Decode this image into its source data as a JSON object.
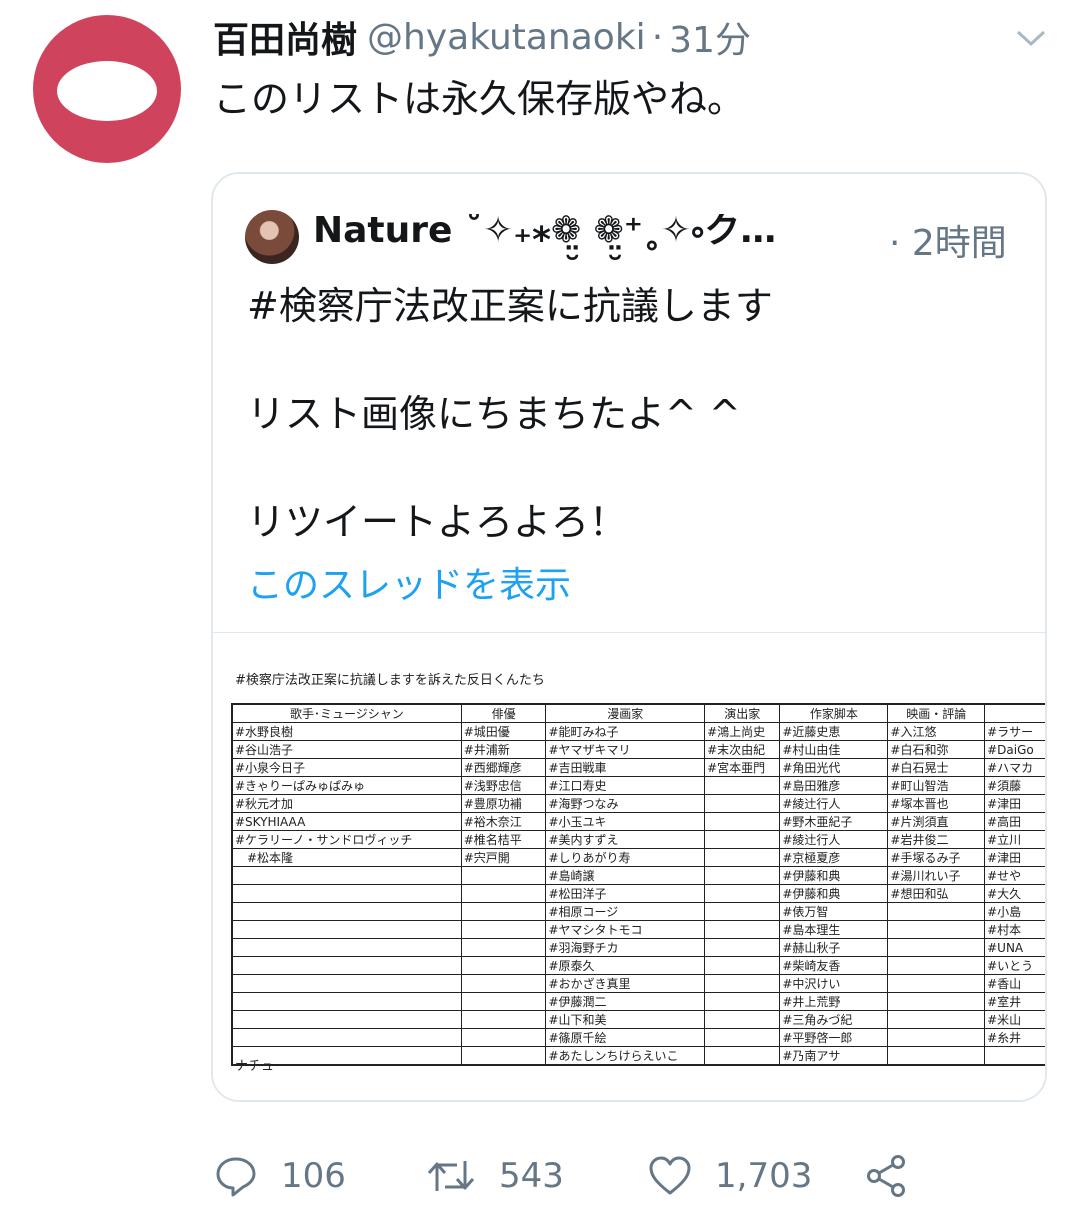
{
  "tweet": {
    "author_name": "百田尚樹",
    "author_handle": "@hyakutanaoki",
    "separator": "·",
    "time": "31分",
    "text": "このリストは永久保存版やね。"
  },
  "quoted": {
    "author_name": "Nature ˚✧₊⁎❁̤̮ ❁̤̮⁺˳✧༚ク…",
    "time": "· 2時間",
    "lines": [
      "#検察庁法改正案に抗議します",
      "",
      "リスト画像にちまちたよ^ ^",
      "",
      "リツイートよろよろ！"
    ],
    "show_thread": "このスレッドを表示",
    "image": {
      "title": "#検察庁法改正案に抗議しますを訴えた反日くんたち",
      "headers": [
        "歌手･ミュージシャン",
        "俳優",
        "漫画家",
        "演出家",
        "作家脚本",
        "映画・評論",
        ""
      ],
      "rows": [
        [
          "#水野良樹",
          "#城田優",
          "#能町みね子",
          "#鴻上尚史",
          "#近藤史恵",
          "#入江悠",
          "#ラサー"
        ],
        [
          "#谷山浩子",
          "#井浦新",
          "#ヤマザキマリ",
          "#末次由紀",
          "#村山由佳",
          "#白石和弥",
          "#DaiGo"
        ],
        [
          "#小泉今日子",
          "#西郷輝彦",
          "#吉田戦車",
          "#宮本亜門",
          "#角田光代",
          "#白石晃士",
          "#ハマカ"
        ],
        [
          "#きゃりーぱみゅぱみゅ",
          "#浅野忠信",
          "#江口寿史",
          "",
          "#島田雅彦",
          "#町山智浩",
          "#須藤"
        ],
        [
          "#秋元才加",
          "#豊原功補",
          "#海野つなみ",
          "",
          "#綾辻行人",
          "#塚本晋也",
          "#津田"
        ],
        [
          "#SKYHIAAA",
          "#裕木奈江",
          "#小玉ユキ",
          "",
          "#野木亜紀子",
          "#片渕須直",
          "#高田"
        ],
        [
          "#ケラリーノ・サンドロヴィッチ",
          "#椎名桔平",
          "#美内すずえ",
          "",
          "#綾辻行人",
          "#岩井俊二",
          "#立川"
        ],
        [
          "　#松本隆",
          "#宍戸開",
          "#しりあがり寿",
          "",
          "#京極夏彦",
          "#手塚るみ子",
          "#津田"
        ],
        [
          "",
          "",
          "#島崎譲",
          "",
          "#伊藤和典",
          "#湯川れい子",
          "#せや"
        ],
        [
          "",
          "",
          "#松田洋子",
          "",
          "#伊藤和典",
          "#想田和弘",
          "#大久"
        ],
        [
          "",
          "",
          "#相原コージ",
          "",
          "#俵万智",
          "",
          "#小島"
        ],
        [
          "",
          "",
          "#ヤマシタトモコ",
          "",
          "#島本理生",
          "",
          "#村本"
        ],
        [
          "",
          "",
          "#羽海野チカ",
          "",
          "#赫山秋子",
          "",
          "#UNA"
        ],
        [
          "",
          "",
          "#原泰久",
          "",
          "#柴崎友香",
          "",
          "#いとう"
        ],
        [
          "",
          "",
          "#おかざき真里",
          "",
          "#中沢けい",
          "",
          "#香山"
        ],
        [
          "",
          "",
          "#伊藤潤二",
          "",
          "#井上荒野",
          "",
          "#室井"
        ],
        [
          "",
          "",
          "#山下和美",
          "",
          "#三角みづ紀",
          "",
          "#米山"
        ],
        [
          "",
          "",
          "#篠原千絵",
          "",
          "#平野啓一郎",
          "",
          "#糸井"
        ],
        [
          "",
          "",
          "#あたしンちけらえいこ",
          "",
          "#乃南アサ",
          "",
          ""
        ]
      ],
      "footer": "ナチュ"
    }
  },
  "actions": {
    "reply_count": "106",
    "retweet_count": "543",
    "like_count": "1,703"
  },
  "icons": {
    "reply": "reply-icon",
    "retweet": "retweet-icon",
    "like": "like-icon",
    "share": "share-icon",
    "caret": "chevron-down-icon"
  },
  "colors": {
    "accent": "#1da1f2",
    "secondary_text": "#657786",
    "avatar": "#d0435d"
  }
}
